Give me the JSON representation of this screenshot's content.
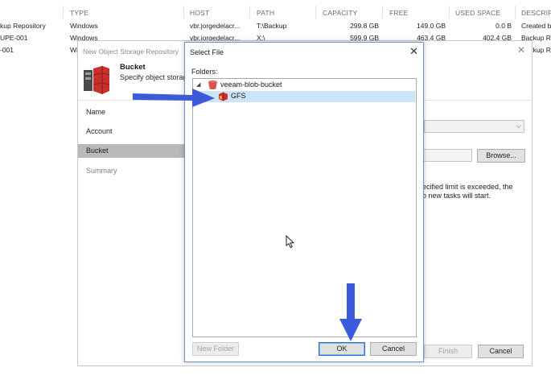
{
  "background_table": {
    "headers": {
      "type": "TYPE",
      "host": "HOST",
      "path": "PATH",
      "capacity": "CAPACITY",
      "free": "FREE",
      "used_space": "USED SPACE",
      "description": "DESCRIPT"
    },
    "rows": [
      {
        "name": "kup Repository",
        "type": "Windows",
        "host": "vbr.jorgedelacr...",
        "path": "T:\\Backup",
        "capacity": "299.8 GB",
        "free": "149.0 GB",
        "used_space": "0.0 B",
        "description": "Created b"
      },
      {
        "name": "UPE-001",
        "type": "Windows",
        "host": "vbr.jorgedelacr...",
        "path": "X:\\",
        "capacity": "599.9 GB",
        "free": "463.4 GB",
        "used_space": "402.4 GB",
        "description": "Backup R"
      },
      {
        "name": "-001",
        "type": "Wi",
        "host": "",
        "path": "",
        "capacity": "",
        "free": "",
        "used_space": "",
        "description": "Backup R"
      }
    ]
  },
  "wizard": {
    "title": "New Object Storage Repository",
    "step_title": "Bucket",
    "step_desc": "Specify object storag",
    "nav": [
      {
        "label": "Name",
        "state": "normal"
      },
      {
        "label": "Account",
        "state": "normal"
      },
      {
        "label": "Bucket",
        "state": "active"
      },
      {
        "label": "Summary",
        "state": "dim"
      }
    ],
    "browse_label": "Browse...",
    "limit_text_1": "ecified limit is exceeded, the",
    "limit_text_2": "o new tasks will start.",
    "finish_label": "Finish",
    "cancel_label": "Cancel"
  },
  "dialog": {
    "title": "Select File",
    "folders_label": "Folders:",
    "tree": [
      {
        "label": "veeam-blob-bucket",
        "icon": "bucket-icon",
        "expanded": true,
        "selected": false
      },
      {
        "label": "GFS",
        "icon": "storage-folder-icon",
        "expanded": false,
        "selected": true
      }
    ],
    "new_folder_label": "New Folder",
    "ok_label": "OK",
    "cancel_label": "Cancel"
  },
  "colors": {
    "selection": "#cce4f7",
    "arrow": "#3b5bdb",
    "bucket_red": "#d9534f",
    "active_nav": "#b9b9b9"
  }
}
